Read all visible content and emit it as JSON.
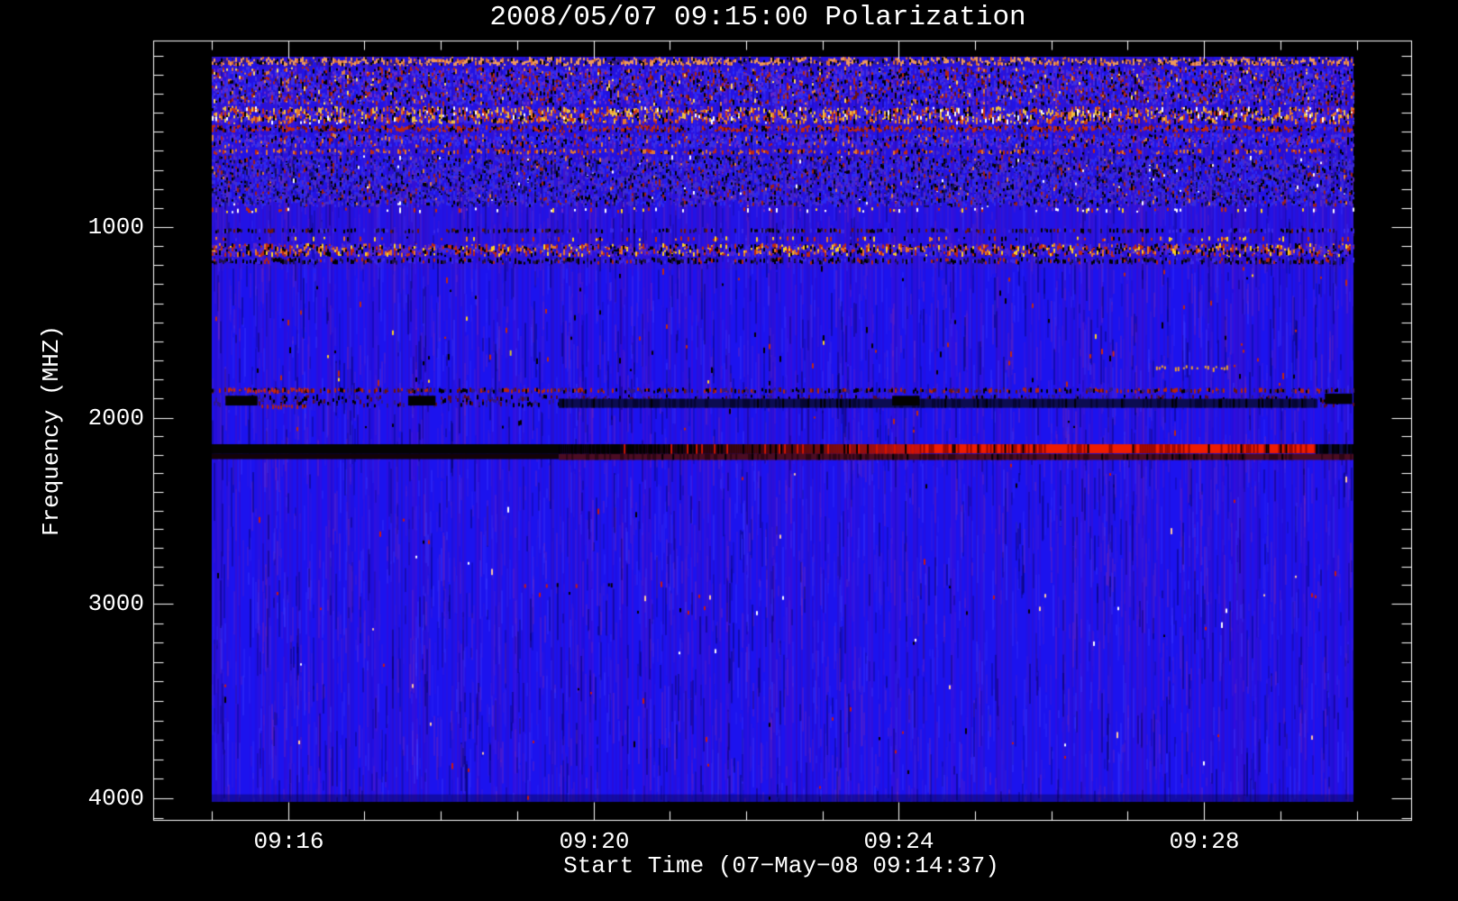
{
  "page": {
    "background": "#000000",
    "text_color": "#ffffff"
  },
  "chart_data": {
    "type": "heatmap",
    "subtype": "radio-spectrogram",
    "title": "2008/05/07 09:15:00 Polarization",
    "xlabel": "Start Time (07−May−08 09:14:37)",
    "ylabel": "Frequency (MHZ)",
    "x_tick_labels": [
      "09:16",
      "09:20",
      "09:24",
      "09:28"
    ],
    "x_minor_tick_interval": "1 minute",
    "y_tick_labels": [
      "1000",
      "2000",
      "3000",
      "4000"
    ],
    "y_tick_values_mhz": [
      1000,
      2000,
      3000,
      4000
    ],
    "y_minor_step_mhz": 100,
    "y_axis_direction": "increasing downward",
    "grid": false,
    "legend": false,
    "base_color": "#1c13ee",
    "frame_color": "#ffffff",
    "underlays": [
      {
        "name": "upper-violet-tint",
        "x": [
          0,
          1
        ],
        "y": [
          0,
          0.285
        ],
        "color": "rgba(90,22,160,0.10)"
      },
      {
        "name": "bottom-dark-row",
        "x": [
          0,
          1
        ],
        "y": [
          0.99,
          1
        ],
        "color": "rgba(0,0,40,0.35)"
      }
    ],
    "bands": [
      {
        "name": "salmon-dash-row-130mhz",
        "freq_mhz": [
          105,
          160
        ],
        "y": [
          0.0,
          0.013
        ],
        "density": 0.7,
        "dash": [
          2,
          3
        ],
        "palette": [
          [
            "#f09a58",
            0.45
          ],
          [
            "#d86a30",
            0.15
          ],
          [
            "#000000",
            0.14
          ],
          [
            "#30188a",
            0.26
          ]
        ]
      },
      {
        "name": "upper-noise-a",
        "freq_mhz": [
          160,
          365
        ],
        "y": [
          0.013,
          0.066
        ],
        "density": 0.8,
        "dash": [
          2,
          3
        ],
        "palette": [
          [
            "#4030e0",
            0.26
          ],
          [
            "#6a28c8",
            0.16
          ],
          [
            "#b42412",
            0.12
          ],
          [
            "#6d140a",
            0.08
          ],
          [
            "#000000",
            0.14
          ],
          [
            "#e08040",
            0.04
          ],
          [
            "#ffd860",
            0.02
          ],
          [
            "#2a2af8",
            0.18
          ]
        ]
      },
      {
        "name": "bright-speckle-band-420mhz",
        "freq_mhz": [
          365,
          460
        ],
        "y": [
          0.066,
          0.091
        ],
        "density": 0.85,
        "dash": [
          2,
          4
        ],
        "palette": [
          [
            "#f0c040",
            0.17
          ],
          [
            "#e87828",
            0.16
          ],
          [
            "#c83014",
            0.15
          ],
          [
            "#ffffff",
            0.04
          ],
          [
            "#000000",
            0.14
          ],
          [
            "#5a22c8",
            0.12
          ],
          [
            "#3a28e8",
            0.22
          ]
        ]
      },
      {
        "name": "red-row-480mhz",
        "freq_mhz": [
          460,
          505
        ],
        "y": [
          0.091,
          0.102
        ],
        "density": 0.75,
        "dash": [
          2,
          3
        ],
        "palette": [
          [
            "#c02810",
            0.42
          ],
          [
            "#7a1208",
            0.14
          ],
          [
            "#000000",
            0.16
          ],
          [
            "#3a28e8",
            0.28
          ]
        ]
      },
      {
        "name": "upper-noise-b",
        "freq_mhz": [
          505,
          590
        ],
        "y": [
          0.102,
          0.123
        ],
        "density": 0.7,
        "dash": [
          2,
          3
        ],
        "palette": [
          [
            "#4030e0",
            0.28
          ],
          [
            "#6a28c8",
            0.16
          ],
          [
            "#b42412",
            0.12
          ],
          [
            "#000000",
            0.13
          ],
          [
            "#e08040",
            0.05
          ],
          [
            "#2a2af8",
            0.26
          ]
        ]
      },
      {
        "name": "orange-dash-row-600mhz",
        "freq_mhz": [
          590,
          625
        ],
        "y": [
          0.123,
          0.132
        ],
        "density": 0.4,
        "dash": [
          2,
          3
        ],
        "palette": [
          [
            "#e07830",
            0.3
          ],
          [
            "#c02810",
            0.3
          ],
          [
            "#000000",
            0.15
          ],
          [
            "#3f2cd2",
            0.25
          ]
        ]
      },
      {
        "name": "mottled-noise-620-900mhz",
        "freq_mhz": [
          625,
          900
        ],
        "y": [
          0.132,
          0.202
        ],
        "density": 0.85,
        "dash": [
          2,
          3
        ],
        "palette": [
          [
            "#3f2cd2",
            0.26
          ],
          [
            "#5a28c0",
            0.16
          ],
          [
            "#16105e",
            0.16
          ],
          [
            "#000000",
            0.12
          ],
          [
            "#2a2af4",
            0.22
          ],
          [
            "#a02012",
            0.06
          ],
          [
            "#e08040",
            0.01
          ],
          [
            "#ffffff",
            0.01
          ]
        ]
      },
      {
        "name": "faint-dot-row-910mhz",
        "freq_mhz": [
          900,
          935
        ],
        "y": [
          0.202,
          0.21
        ],
        "density": 0.1,
        "dash": [
          2,
          3
        ],
        "palette": [
          [
            "#ffffff",
            0.3
          ],
          [
            "#ffd020",
            0.2
          ],
          [
            "#c02810",
            0.3
          ],
          [
            "#6a28c8",
            0.2
          ]
        ]
      },
      {
        "name": "dark-row-1010mhz",
        "freq_mhz": [
          1000,
          1035
        ],
        "y": [
          0.23,
          0.237
        ],
        "density": 0.5,
        "dash": [
          3,
          2
        ],
        "palette": [
          [
            "#000000",
            0.3
          ],
          [
            "#20104a",
            0.25
          ],
          [
            "#70150c",
            0.15
          ],
          [
            "#3a28e8",
            0.3
          ]
        ]
      },
      {
        "name": "colored-dash-row-1055mhz",
        "freq_mhz": [
          1040,
          1075
        ],
        "y": [
          0.241,
          0.248
        ],
        "density": 0.18,
        "dash": [
          2,
          4
        ],
        "palette": [
          [
            "#c02810",
            0.35
          ],
          [
            "#e87828",
            0.2
          ],
          [
            "#ffd020",
            0.15
          ],
          [
            "#000000",
            0.1
          ],
          [
            "#3a28e8",
            0.2
          ]
        ]
      },
      {
        "name": "speckle-band-1120mhz",
        "freq_mhz": [
          1085,
          1160
        ],
        "y": [
          0.25,
          0.269
        ],
        "density": 0.8,
        "dash": [
          2,
          4
        ],
        "palette": [
          [
            "#c02810",
            0.2
          ],
          [
            "#e87828",
            0.12
          ],
          [
            "#ffd020",
            0.08
          ],
          [
            "#000000",
            0.2
          ],
          [
            "#5a22c8",
            0.16
          ],
          [
            "#3a28e8",
            0.24
          ]
        ]
      },
      {
        "name": "dark-row-1180mhz",
        "freq_mhz": [
          1160,
          1200
        ],
        "y": [
          0.269,
          0.279
        ],
        "density": 0.45,
        "dash": [
          3,
          2
        ],
        "palette": [
          [
            "#000000",
            0.35
          ],
          [
            "#20104a",
            0.25
          ],
          [
            "#b42412",
            0.1
          ],
          [
            "#3a28e8",
            0.3
          ]
        ]
      },
      {
        "name": "quiet-upper-mid",
        "freq_mhz": [
          1200,
          1840
        ],
        "y": [
          0.279,
          0.444
        ],
        "density": 0.004,
        "dash": [
          2,
          5
        ],
        "palette": [
          [
            "#c02810",
            0.4
          ],
          [
            "#000000",
            0.4
          ],
          [
            "#ffd020",
            0.2
          ]
        ]
      },
      {
        "name": "speckle-row-1860mhz",
        "freq_mhz": [
          1840,
          1880
        ],
        "y": [
          0.444,
          0.452
        ],
        "density": 0.4,
        "dash": [
          3,
          2
        ],
        "palette": [
          [
            "#b42412",
            0.25
          ],
          [
            "#6d140a",
            0.2
          ],
          [
            "#000000",
            0.25
          ],
          [
            "#30188a",
            0.3
          ]
        ]
      },
      {
        "name": "segment-row-1900mhz",
        "freq_mhz": [
          1880,
          1950
        ],
        "y": [
          0.453,
          0.471
        ],
        "density": 0.25,
        "dash": [
          3,
          2
        ],
        "palette": [
          [
            "#5a0a28",
            0.25
          ],
          [
            "#000000",
            0.3
          ],
          [
            "#30188a",
            0.45
          ]
        ]
      },
      {
        "name": "quiet-above-2200-band",
        "freq_mhz": [
          1950,
          2140
        ],
        "y": [
          0.472,
          0.519
        ],
        "density": 0.003,
        "dash": [
          2,
          4
        ],
        "palette": [
          [
            "#c02810",
            0.5
          ],
          [
            "#000000",
            0.5
          ]
        ]
      },
      {
        "name": "quiet-lower-half",
        "freq_mhz": [
          2220,
          4010
        ],
        "y": [
          0.542,
          0.999
        ],
        "density": 0.0012,
        "dash": [
          2,
          5
        ],
        "palette": [
          [
            "#cc1810",
            0.35
          ],
          [
            "#000000",
            0.35
          ],
          [
            "#ffc8a0",
            0.15
          ],
          [
            "#ffffff",
            0.15
          ]
        ]
      }
    ],
    "features": [
      {
        "type": "rect-noise",
        "name": "navy-smear-1920mhz",
        "x": [
          0.304,
          0.967
        ],
        "y": [
          0.459,
          0.471
        ],
        "color": "#0c0c52",
        "dark": "#04042a",
        "black_p": 0.08
      },
      {
        "type": "rect",
        "name": "black-segment-1",
        "x": [
          0.012,
          0.04
        ],
        "y": [
          0.455,
          0.468
        ],
        "color": "#020202"
      },
      {
        "type": "rect",
        "name": "black-segment-2",
        "x": [
          0.172,
          0.196
        ],
        "y": [
          0.455,
          0.468
        ],
        "color": "#020202"
      },
      {
        "type": "rect",
        "name": "black-segment-3",
        "x": [
          0.596,
          0.62
        ],
        "y": [
          0.455,
          0.468
        ],
        "color": "#020202"
      },
      {
        "type": "rect",
        "name": "black-segment-4",
        "x": [
          0.975,
          0.999
        ],
        "y": [
          0.452,
          0.466
        ],
        "color": "#020202"
      },
      {
        "type": "dash-row",
        "name": "red-streak-left-1850mhz",
        "x": [
          0.012,
          0.085
        ],
        "y": [
          0.444,
          0.452
        ],
        "color": "#d02810",
        "density": 0.8
      },
      {
        "type": "dash-row",
        "name": "red-speckle-under-left",
        "x": [
          0.034,
          0.082
        ],
        "y": [
          0.466,
          0.472
        ],
        "color": "#b42412",
        "density": 0.6
      },
      {
        "type": "dash-row",
        "name": "orange-dotted-streak-1730mhz",
        "x": [
          0.827,
          0.89
        ],
        "y": [
          0.414,
          0.421
        ],
        "color": "#f0a028",
        "density": 0.5
      },
      {
        "type": "rect",
        "name": "band2200-black-left",
        "x": [
          0.0,
          0.304
        ],
        "y": [
          0.52,
          0.533
        ],
        "color": "#030303"
      },
      {
        "type": "stripes-gradient",
        "name": "band2200-transition",
        "x": [
          0.304,
          0.62
        ],
        "y": [
          0.52,
          0.533
        ],
        "from": "#050000",
        "to": "#d81400"
      },
      {
        "type": "rect-noise",
        "name": "band2200-bright-red",
        "x": [
          0.62,
          0.967
        ],
        "y": [
          0.52,
          0.532
        ],
        "color": "#ee1c00",
        "dark": "#7a0000",
        "black_p": 0.1
      },
      {
        "type": "rect-noise",
        "name": "band2200-fade-right",
        "x": [
          0.967,
          1.0
        ],
        "y": [
          0.52,
          0.533
        ],
        "color": "#0d0d3f",
        "dark": "#000008",
        "black_p": 0.4
      },
      {
        "type": "rect",
        "name": "maroon-row-left",
        "x": [
          0.0,
          0.304
        ],
        "y": [
          0.533,
          0.54
        ],
        "color": "#120208"
      },
      {
        "type": "rect-noise",
        "name": "maroon-row-2200mhz",
        "x": [
          0.304,
          1.0
        ],
        "y": [
          0.533,
          0.541
        ],
        "color": "#4a0c22",
        "dark": "#240410",
        "black_p": 0.05
      },
      {
        "type": "dash-row",
        "name": "white-dot-pair-2650mhz",
        "x": [
          0.18,
          0.195
        ],
        "y": [
          0.648,
          0.654
        ],
        "color": "mix",
        "density": 0.3
      },
      {
        "type": "single-dash",
        "name": "yellow-dot-1650mhz",
        "x": 0.261,
        "y": 0.394,
        "color": "#d8c428"
      },
      {
        "type": "single-dash",
        "name": "red-dot-a",
        "x": 0.779,
        "y": 0.392,
        "color": "#d02810"
      },
      {
        "type": "single-dash",
        "name": "red-dot-b",
        "x": 0.789,
        "y": 0.395,
        "color": "#d02810"
      },
      {
        "type": "dash-row",
        "name": "sparse-dot-row-2950mhz",
        "x": [
          0.0,
          1.0
        ],
        "y": [
          0.718,
          0.728
        ],
        "color": "mix",
        "density": 0.018
      },
      {
        "type": "dash-row",
        "name": "sparse-dot-row-3010mhz",
        "x": [
          0.0,
          1.0
        ],
        "y": [
          0.736,
          0.748
        ],
        "color": "mix",
        "density": 0.015
      },
      {
        "type": "dash-row",
        "name": "sparse-dot-row-2900mhz",
        "x": [
          0.25,
          0.35
        ],
        "y": [
          0.706,
          0.712
        ],
        "color": "mix",
        "density": 0.05
      }
    ],
    "mix_palette": [
      [
        "#cc1810",
        0.4
      ],
      [
        "#000000",
        0.3
      ],
      [
        "#ffffff",
        0.15
      ],
      [
        "#ffc8a0",
        0.15
      ]
    ]
  }
}
